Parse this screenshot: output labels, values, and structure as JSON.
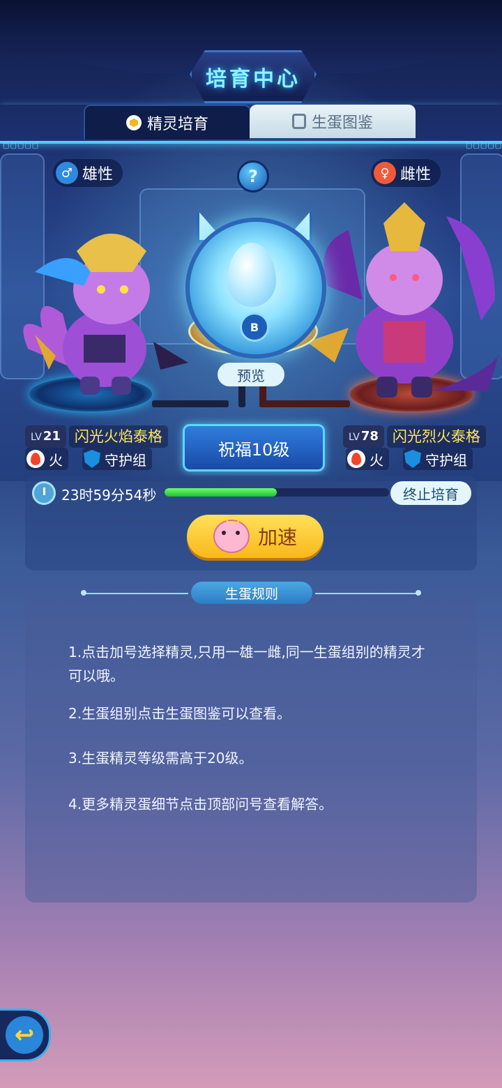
{
  "header": {
    "title": "培育中心"
  },
  "tabs": [
    {
      "label": "精灵培育",
      "active": true,
      "icon": "hexagon-icon"
    },
    {
      "label": "生蛋图鉴",
      "active": false,
      "icon": "book-icon"
    }
  ],
  "parents": {
    "male": {
      "gender_label": "雄性",
      "level_prefix": "LV",
      "level": "21",
      "name": "闪光火焰泰格",
      "element": "火",
      "group": "守护组"
    },
    "female": {
      "gender_label": "雌性",
      "level_prefix": "LV",
      "level": "78",
      "name": "闪光烈火泰格",
      "element": "火",
      "group": "守护组"
    }
  },
  "help_label": "?",
  "incubator": {
    "badge": "B",
    "preview_label": "预览"
  },
  "blessing": "祝福10级",
  "timer": {
    "remaining": "23时59分54秒",
    "progress": 0.5,
    "stop_label": "终止培育",
    "speed_label": "加速"
  },
  "rules": {
    "title": "生蛋规则",
    "items": [
      "1.点击加号选择精灵,只用一雄一雌,同一生蛋组别的精灵才可以哦。",
      "2.生蛋组别点击生蛋图鉴可以查看。",
      "3.生蛋精灵等级需高于20级。",
      "4.更多精灵蛋细节点击顶部问号查看解答。"
    ]
  },
  "colors": {
    "accent_cyan": "#4fd0ff",
    "name_yellow": "#ffe55a",
    "speed_yellow": "#f8b81a",
    "progress_green": "#1fbf35"
  }
}
